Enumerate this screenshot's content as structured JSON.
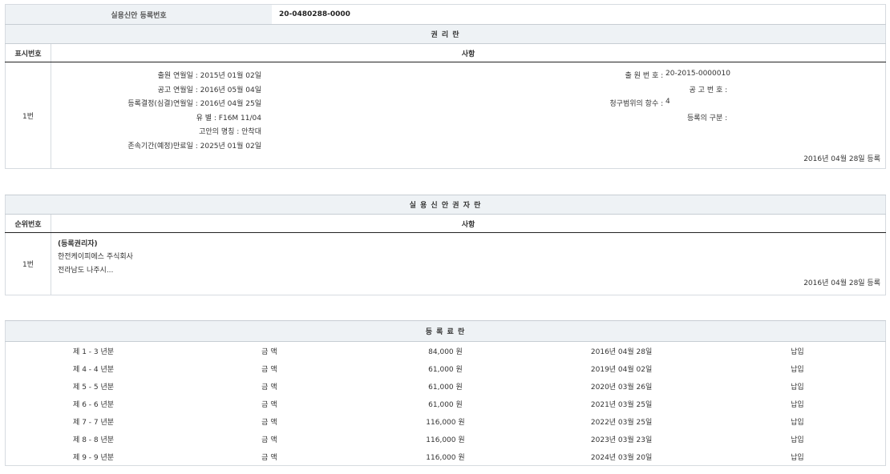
{
  "header": {
    "label": "실용신안 등록번호",
    "number": "20-0480288-0000"
  },
  "rights": {
    "title": "권 리 란",
    "col_num": "표시번호",
    "col_item": "사항",
    "entry_no": "1번",
    "left": [
      {
        "label": "출원 연월일",
        "value": "2015년 01월 02일"
      },
      {
        "label": "공고 연월일",
        "value": "2016년 05월 04일"
      },
      {
        "label": "등록결정(심결)연월일",
        "value": "2016년 04월 25일"
      },
      {
        "label": "유 별",
        "value": "F16M 11/04"
      },
      {
        "label": "고안의 명칭",
        "value": "안착대"
      },
      {
        "label": "존속기간(예정)만료일",
        "value": "2025년 01월 02일"
      }
    ],
    "right": [
      {
        "label": "출 원 번 호",
        "value": "20-2015-0000010"
      },
      {
        "label": "공 고 번 호",
        "value": ""
      },
      {
        "label": "청구범위의 항수",
        "value": "4"
      },
      {
        "label": "등록의 구분",
        "value": ""
      }
    ],
    "registered": "2016년 04월 28일 등록"
  },
  "holders": {
    "title": "실 용 신 안 권 자 란",
    "col_num": "순위번호",
    "col_item": "사항",
    "entry_no": "1번",
    "role": "(등록권리자)",
    "name": "한전케이피에스 주식회사",
    "address": "전라남도 나주시...",
    "registered": "2016년 04월 28일 등록"
  },
  "fees": {
    "title": "등 록 료 란",
    "amount_label": "금 액",
    "rows": [
      {
        "period": "제 1 - 3 년분",
        "amount": "84,000 원",
        "date": "2016년 04월 28일",
        "status": "납입"
      },
      {
        "period": "제 4 - 4 년분",
        "amount": "61,000 원",
        "date": "2019년 04월 02일",
        "status": "납입"
      },
      {
        "period": "제 5 - 5 년분",
        "amount": "61,000 원",
        "date": "2020년 03월 26일",
        "status": "납입"
      },
      {
        "period": "제 6 - 6 년분",
        "amount": "61,000 원",
        "date": "2021년 03월 25일",
        "status": "납입"
      },
      {
        "period": "제 7 - 7 년분",
        "amount": "116,000 원",
        "date": "2022년 03월 25일",
        "status": "납입"
      },
      {
        "period": "제 8 - 8 년분",
        "amount": "116,000 원",
        "date": "2023년 03월 23일",
        "status": "납입"
      },
      {
        "period": "제 9 - 9 년분",
        "amount": "116,000 원",
        "date": "2024년 03월 20일",
        "status": "납입"
      }
    ]
  }
}
